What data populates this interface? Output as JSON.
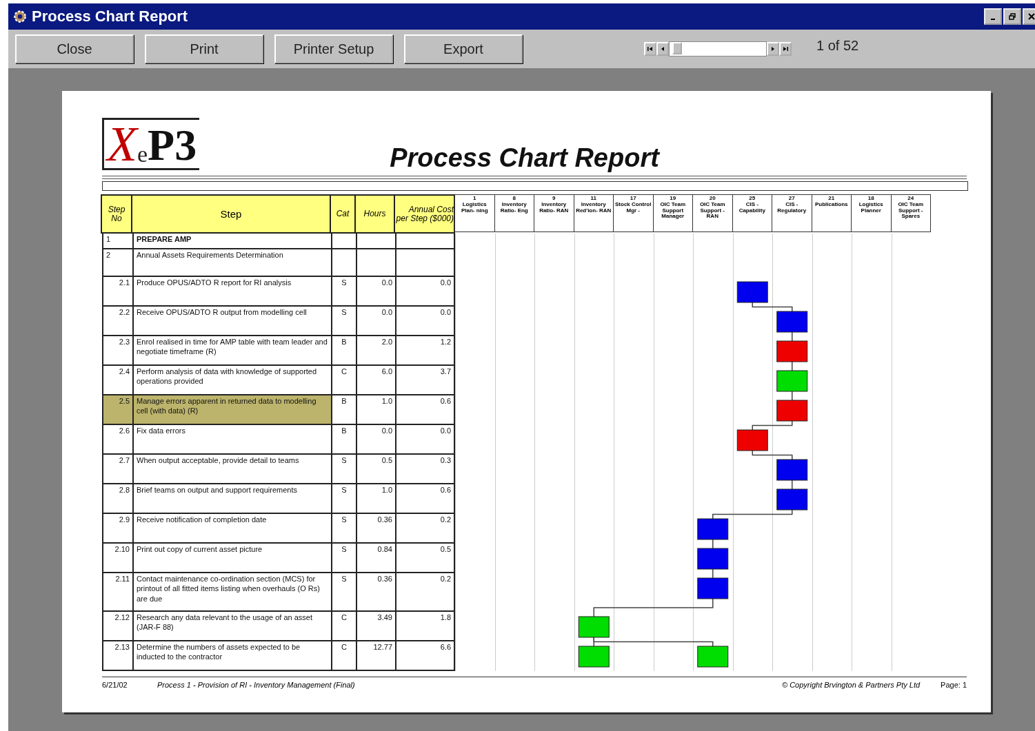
{
  "window": {
    "title": "Process Chart Report"
  },
  "toolbar": {
    "buttons": [
      {
        "label": "Close"
      },
      {
        "label": "Print"
      },
      {
        "label": "Printer Setup"
      },
      {
        "label": "Export"
      }
    ],
    "page_counter": "1 of 52"
  },
  "report": {
    "title": "Process Chart Report",
    "logo": {
      "letter_1": "X",
      "letter_2": "e",
      "rest": "P3"
    },
    "columns": [
      {
        "label": "Step No"
      },
      {
        "label": "Step"
      },
      {
        "label": "Cat"
      },
      {
        "label": "Hours"
      },
      {
        "label": "Annual Cost per Step ($000)"
      }
    ],
    "roles": [
      {
        "number": "1",
        "name": "Logistics Plan- ning"
      },
      {
        "number": "8",
        "name": "Inventory Ratio- Eng"
      },
      {
        "number": "9",
        "name": "Inventory Ratio- RAN"
      },
      {
        "number": "11",
        "name": "Inventory Red'ion- RAN"
      },
      {
        "number": "17",
        "name": "Stock Control Mgr -"
      },
      {
        "number": "19",
        "name": "OIC Team Support Manager"
      },
      {
        "number": "20",
        "name": "OIC Team Support - RAN"
      },
      {
        "number": "25",
        "name": "CIS - Capability"
      },
      {
        "number": "27",
        "name": "CIS - Regulatory"
      },
      {
        "number": "21",
        "name": "Publications"
      },
      {
        "number": "18",
        "name": "Logistics Planner"
      },
      {
        "number": "24",
        "name": "OIC Team Support - Spares"
      }
    ],
    "rows": [
      {
        "kind": "section",
        "step_no": "1",
        "step": "PREPARE AMP",
        "highlighted": false
      },
      {
        "kind": "section",
        "step_no": "2",
        "step": "Annual Assets Requirements Determination",
        "highlighted": false
      },
      {
        "kind": "step",
        "step_no": "2.1",
        "step": "Produce OPUS/ADTO R report for RI analysis",
        "cat": "S",
        "hours": "0.0",
        "cost": "0.0",
        "highlighted": false,
        "lanes": [
          {
            "box": false
          },
          {
            "box": false
          },
          {
            "box": false
          },
          {
            "box": false
          },
          {
            "box": false
          },
          {
            "box": false
          },
          {
            "box": false
          },
          {
            "box": true,
            "color": "#0000ee"
          },
          {
            "box": false
          },
          {
            "box": false
          },
          {
            "box": false
          },
          {
            "box": false
          }
        ]
      },
      {
        "kind": "step",
        "step_no": "2.2",
        "step": "Receive OPUS/ADTO R output from modelling cell",
        "cat": "S",
        "hours": "0.0",
        "cost": "0.0",
        "highlighted": false,
        "lanes": [
          {
            "box": false
          },
          {
            "box": false
          },
          {
            "box": false
          },
          {
            "box": false
          },
          {
            "box": false
          },
          {
            "box": false
          },
          {
            "box": false
          },
          {
            "box": false
          },
          {
            "box": true,
            "color": "#0000ee"
          },
          {
            "box": false
          },
          {
            "box": false
          },
          {
            "box": false
          }
        ]
      },
      {
        "kind": "step",
        "step_no": "2.3",
        "step": "Enrol realised in time for AMP table with team leader and negotiate timeframe (R)",
        "cat": "B",
        "hours": "2.0",
        "cost": "1.2",
        "highlighted": false,
        "lanes": [
          {
            "box": false
          },
          {
            "box": false
          },
          {
            "box": false
          },
          {
            "box": false
          },
          {
            "box": false
          },
          {
            "box": false
          },
          {
            "box": false
          },
          {
            "box": false
          },
          {
            "box": true,
            "color": "#ee0000"
          },
          {
            "box": false
          },
          {
            "box": false
          },
          {
            "box": false
          }
        ]
      },
      {
        "kind": "step",
        "step_no": "2.4",
        "step": "Perform analysis of data with knowledge of supported operations provided",
        "cat": "C",
        "hours": "6.0",
        "cost": "3.7",
        "highlighted": false,
        "lanes": [
          {
            "box": false
          },
          {
            "box": false
          },
          {
            "box": false
          },
          {
            "box": false
          },
          {
            "box": false
          },
          {
            "box": false
          },
          {
            "box": false
          },
          {
            "box": false
          },
          {
            "box": true,
            "color": "#00dd00"
          },
          {
            "box": false
          },
          {
            "box": false
          },
          {
            "box": false
          }
        ]
      },
      {
        "kind": "step",
        "step_no": "2.5",
        "step": "Manage errors apparent in returned data to modelling cell (with data) (R)",
        "cat": "B",
        "hours": "1.0",
        "cost": "0.6",
        "highlighted": true,
        "lanes": [
          {
            "box": false
          },
          {
            "box": false
          },
          {
            "box": false
          },
          {
            "box": false
          },
          {
            "box": false
          },
          {
            "box": false
          },
          {
            "box": false
          },
          {
            "box": false
          },
          {
            "box": true,
            "color": "#ee0000"
          },
          {
            "box": false
          },
          {
            "box": false
          },
          {
            "box": false
          }
        ]
      },
      {
        "kind": "step",
        "step_no": "2.6",
        "step": "Fix data errors",
        "cat": "B",
        "hours": "0.0",
        "cost": "0.0",
        "highlighted": false,
        "lanes": [
          {
            "box": false
          },
          {
            "box": false
          },
          {
            "box": false
          },
          {
            "box": false
          },
          {
            "box": false
          },
          {
            "box": false
          },
          {
            "box": false
          },
          {
            "box": true,
            "color": "#ee0000"
          },
          {
            "box": false
          },
          {
            "box": false
          },
          {
            "box": false
          },
          {
            "box": false
          }
        ]
      },
      {
        "kind": "step",
        "step_no": "2.7",
        "step": "When output acceptable, provide detail to teams",
        "cat": "S",
        "hours": "0.5",
        "cost": "0.3",
        "highlighted": false,
        "lanes": [
          {
            "box": false
          },
          {
            "box": false
          },
          {
            "box": false
          },
          {
            "box": false
          },
          {
            "box": false
          },
          {
            "box": false
          },
          {
            "box": false
          },
          {
            "box": false
          },
          {
            "box": true,
            "color": "#0000ee"
          },
          {
            "box": false
          },
          {
            "box": false
          },
          {
            "box": false
          }
        ]
      },
      {
        "kind": "step",
        "step_no": "2.8",
        "step": "Brief teams on output and support requirements",
        "cat": "S",
        "hours": "1.0",
        "cost": "0.6",
        "highlighted": false,
        "lanes": [
          {
            "box": false
          },
          {
            "box": false
          },
          {
            "box": false
          },
          {
            "box": false
          },
          {
            "box": false
          },
          {
            "box": false
          },
          {
            "box": false
          },
          {
            "box": false
          },
          {
            "box": true,
            "color": "#0000ee"
          },
          {
            "box": false
          },
          {
            "box": false
          },
          {
            "box": false
          }
        ]
      },
      {
        "kind": "step",
        "step_no": "2.9",
        "step": "Receive notification of completion date",
        "cat": "S",
        "hours": "0.36",
        "cost": "0.2",
        "highlighted": false,
        "lanes": [
          {
            "box": false
          },
          {
            "box": false
          },
          {
            "box": false
          },
          {
            "box": false
          },
          {
            "box": false
          },
          {
            "box": false
          },
          {
            "box": true,
            "color": "#0000ee"
          },
          {
            "box": false
          },
          {
            "box": false
          },
          {
            "box": false
          },
          {
            "box": false
          },
          {
            "box": false
          }
        ]
      },
      {
        "kind": "step",
        "step_no": "2.10",
        "step": "Print out copy of current asset picture",
        "cat": "S",
        "hours": "0.84",
        "cost": "0.5",
        "highlighted": false,
        "lanes": [
          {
            "box": false
          },
          {
            "box": false
          },
          {
            "box": false
          },
          {
            "box": false
          },
          {
            "box": false
          },
          {
            "box": false
          },
          {
            "box": true,
            "color": "#0000ee"
          },
          {
            "box": false
          },
          {
            "box": false
          },
          {
            "box": false
          },
          {
            "box": false
          },
          {
            "box": false
          }
        ]
      },
      {
        "kind": "step",
        "step_no": "2.11",
        "step": "Contact maintenance co-ordination section (MCS) for printout of all fitted items listing when overhauls (O Rs) are due",
        "cat": "S",
        "hours": "0.36",
        "cost": "0.2",
        "highlighted": false,
        "lanes": [
          {
            "box": false
          },
          {
            "box": false
          },
          {
            "box": false
          },
          {
            "box": false
          },
          {
            "box": false
          },
          {
            "box": false
          },
          {
            "box": true,
            "color": "#0000ee"
          },
          {
            "box": false
          },
          {
            "box": false
          },
          {
            "box": false
          },
          {
            "box": false
          },
          {
            "box": false
          }
        ]
      },
      {
        "kind": "step",
        "step_no": "2.12",
        "step": "Research any data relevant to the usage of an asset (JAR-F 88)",
        "cat": "C",
        "hours": "3.49",
        "cost": "1.8",
        "highlighted": false,
        "lanes": [
          {
            "box": false
          },
          {
            "box": false
          },
          {
            "box": false
          },
          {
            "box": true,
            "color": "#00dd00"
          },
          {
            "box": false
          },
          {
            "box": false
          },
          {
            "box": false
          },
          {
            "box": false
          },
          {
            "box": false
          },
          {
            "box": false
          },
          {
            "box": false
          },
          {
            "box": false
          }
        ]
      },
      {
        "kind": "step",
        "step_no": "2.13",
        "step": "Determine the numbers of assets expected to be inducted to the contractor",
        "cat": "C",
        "hours": "12.77",
        "cost": "6.6",
        "highlighted": false,
        "lanes": [
          {
            "box": false
          },
          {
            "box": false
          },
          {
            "box": false
          },
          {
            "box": true,
            "color": "#00dd00"
          },
          {
            "box": false
          },
          {
            "box": false
          },
          {
            "box": true,
            "color": "#00dd00"
          },
          {
            "box": false
          },
          {
            "box": false
          },
          {
            "box": false
          },
          {
            "box": false
          },
          {
            "box": false
          }
        ]
      }
    ],
    "footer": {
      "date": "6/21/02",
      "process": "Process 1 - Provision of RI - Inventory Management (Final)",
      "copyright": "© Copyright Brvington & Partners Pty Ltd",
      "page": "Page: 1"
    }
  }
}
